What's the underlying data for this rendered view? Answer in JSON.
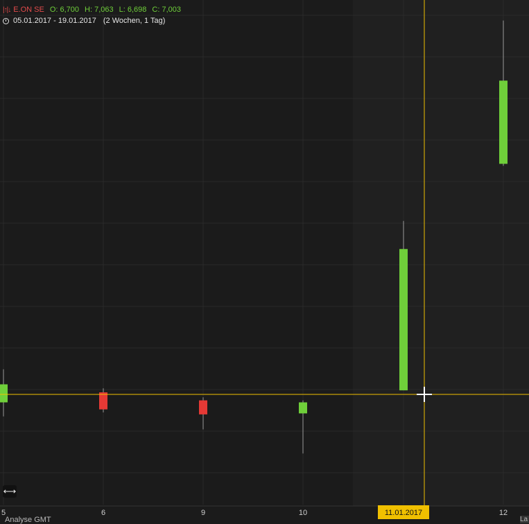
{
  "header": {
    "symbol": "E.ON SE",
    "open": "O: 6,700",
    "high": "H: 7,063",
    "low": "L: 6,698",
    "close": "C: 7,003",
    "date_range": "05.01.2017 - 19.01.2017",
    "span": "(2 Wochen, 1 Tag)"
  },
  "footer": {
    "left_label": "Analyse GMT",
    "right_label": "La"
  },
  "crosshair": {
    "date_label": "11.01.2017"
  },
  "colors": {
    "up": "#6fcf3a",
    "down": "#e53935",
    "crosshair": "#f0c000",
    "background": "#1b1b1b",
    "grid": "#2a2a2a"
  },
  "chart_data": {
    "type": "candlestick",
    "ylim": [
      6.58,
      7.08
    ],
    "crosshair_y": 6.69,
    "x_ticks": [
      "5",
      "6",
      "9",
      "10",
      "11.01.2017",
      "12"
    ],
    "candles": [
      {
        "label": "5",
        "open": 6.682,
        "high": 6.715,
        "low": 6.668,
        "close": 6.7
      },
      {
        "label": "6",
        "open": 6.692,
        "high": 6.696,
        "low": 6.672,
        "close": 6.675
      },
      {
        "label": "9",
        "open": 6.684,
        "high": 6.687,
        "low": 6.655,
        "close": 6.67
      },
      {
        "label": "10",
        "open": 6.671,
        "high": 6.684,
        "low": 6.631,
        "close": 6.682
      },
      {
        "label": "11",
        "open": 6.694,
        "high": 6.863,
        "low": 6.694,
        "close": 6.835
      },
      {
        "label": "12",
        "open": 6.92,
        "high": 7.063,
        "low": 6.918,
        "close": 7.003
      }
    ]
  }
}
